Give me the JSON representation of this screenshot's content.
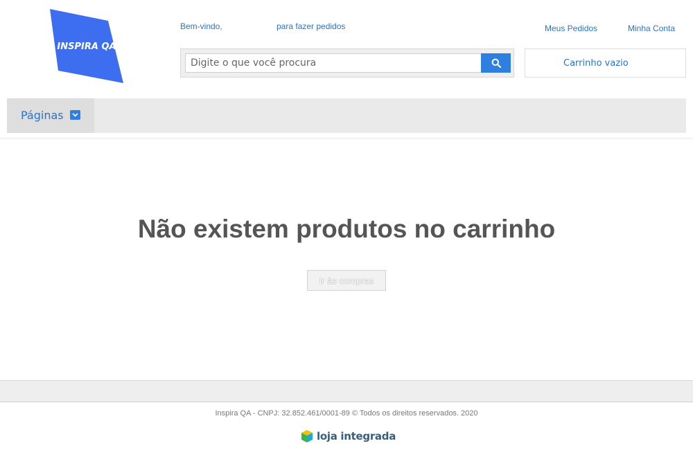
{
  "header": {
    "logo_text": "INSPIRA QA",
    "welcome_prefix": "Bem-vindo,",
    "welcome_suffix": "para fazer pedidos",
    "my_orders": "Meus Pedidos",
    "my_account": "Minha Conta"
  },
  "search": {
    "placeholder": "Digite o que você procura",
    "value": "",
    "button_icon": "search-icon"
  },
  "cart": {
    "label": "Carrinho vazio"
  },
  "nav": {
    "pages_label": "Páginas",
    "pages_icon": "chevron-down-icon"
  },
  "main": {
    "empty_title": "Não existem produtos no carrinho",
    "shop_button": "Ir às compras"
  },
  "footer": {
    "copyright": "Inspira QA - CNPJ: 32.852.461/0001-89 © Todos os direitos reservados. 2020",
    "platform_logo": "loja integrada"
  },
  "colors": {
    "link": "#2a73c9",
    "accent": "#2f7fe0",
    "logo_blue": "#3d6ef0",
    "title": "#555555"
  }
}
